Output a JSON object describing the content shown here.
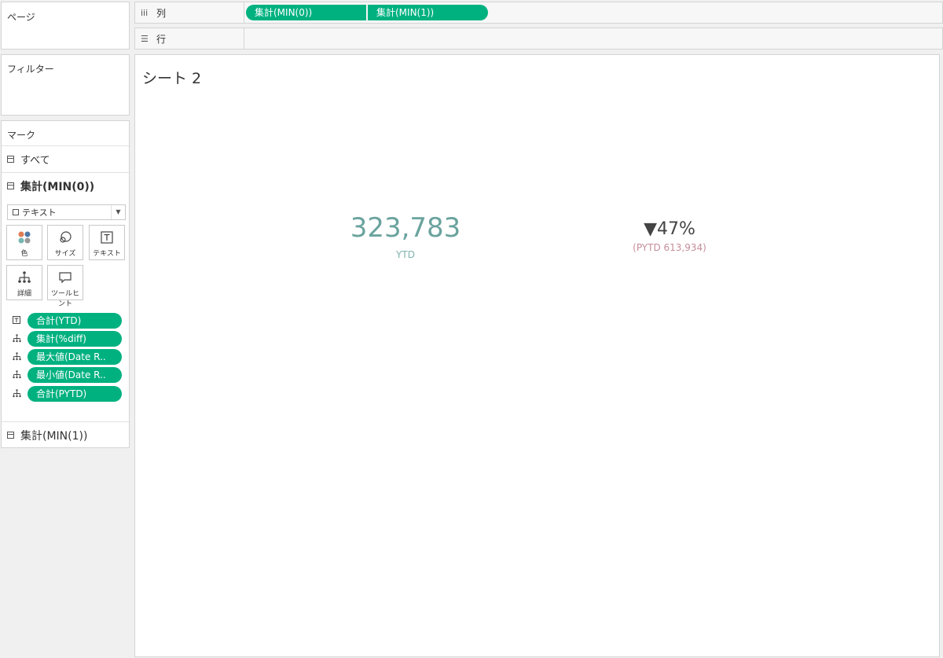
{
  "pages_card": {
    "title": "ページ"
  },
  "filters_card": {
    "title": "フィルター"
  },
  "columns_shelf": {
    "label": "列",
    "pills": [
      "集計(MIN(0))",
      "集計(MIN(1))"
    ]
  },
  "rows_shelf": {
    "label": "行"
  },
  "marks": {
    "title": "マーク",
    "all_label": "すべて",
    "active_label": "集計(MIN(0))",
    "mark_type": "テキスト",
    "buttons": {
      "color": "色",
      "size": "サイズ",
      "text": "テキスト",
      "detail": "詳細",
      "tooltip": "ツールヒント"
    },
    "fields": [
      {
        "icon": "text-icon",
        "label": "合計(YTD)"
      },
      {
        "icon": "detail-icon",
        "label": "集計(%diff)"
      },
      {
        "icon": "detail-icon",
        "label": "最大値(Date R.."
      },
      {
        "icon": "detail-icon",
        "label": "最小値(Date R.."
      },
      {
        "icon": "detail-icon",
        "label": "合計(PYTD)"
      }
    ],
    "second_label": "集計(MIN(1))"
  },
  "sheet": {
    "title": "シート 2",
    "ytd_value": "323,783",
    "ytd_label": "YTD",
    "diff_value": "▼47%",
    "pytd_text": "(PYTD 613,934)"
  },
  "colors": {
    "pill": "#00b180",
    "ytd": "#6aa39e",
    "pytd": "#c58e9a"
  }
}
